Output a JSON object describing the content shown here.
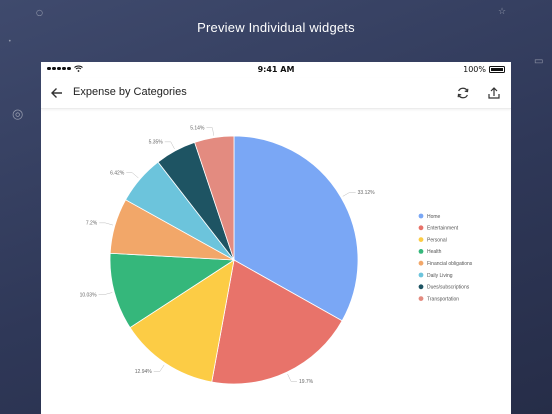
{
  "headline": "Preview Individual widgets",
  "status_bar": {
    "time": "9:41 AM",
    "battery": "100%"
  },
  "app_bar": {
    "title": "Expense by Categories"
  },
  "chart_data": {
    "type": "pie",
    "title": "",
    "slices": [
      {
        "name": "Home",
        "value": 33.12,
        "label": "33.12%",
        "color": "#7aa7f5"
      },
      {
        "name": "Entertainment",
        "value": 19.7,
        "label": "19.7%",
        "color": "#e8736a"
      },
      {
        "name": "Personal",
        "value": 12.94,
        "label": "12.94%",
        "color": "#fccc45"
      },
      {
        "name": "Health",
        "value": 10.03,
        "label": "10.03%",
        "color": "#35b77b"
      },
      {
        "name": "Financial obligations",
        "value": 7.2,
        "label": "7.2%",
        "color": "#f2a769"
      },
      {
        "name": "Daily Living",
        "value": 6.42,
        "label": "6.42%",
        "color": "#6cc4dc"
      },
      {
        "name": "Dues/subscriptions",
        "value": 5.35,
        "label": "5.35%",
        "color": "#1e5463"
      },
      {
        "name": "Transportation",
        "value": 5.14,
        "label": "5.14%",
        "color": "#e38b80"
      }
    ],
    "legend_position": "right"
  }
}
